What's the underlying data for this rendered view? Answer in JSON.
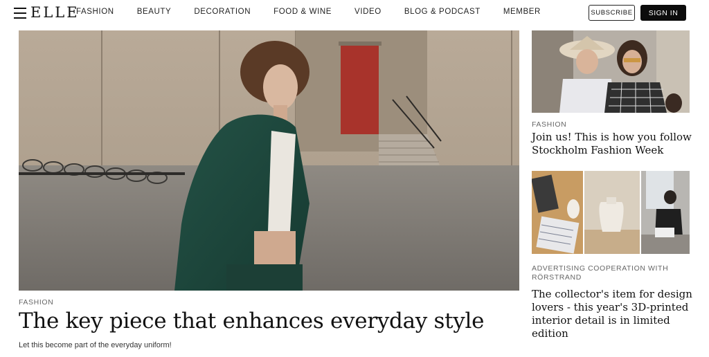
{
  "header": {
    "logo": "ELLE",
    "nav": [
      "FASHION",
      "BEAUTY",
      "DECORATION",
      "FOOD & WINE",
      "VIDEO",
      "BLOG & PODCAST",
      "MEMBER"
    ],
    "subscribe_label": "SUBSCRIBE",
    "signin_label": "SIGN IN"
  },
  "hero": {
    "category": "FASHION",
    "title": "The key piece that enhances everyday style",
    "subtitle": "Let this become part of the everyday uniform!"
  },
  "sidebar": {
    "cards": [
      {
        "category": "FASHION",
        "title": "Join us! This is how you follow Stockholm Fashion Week"
      },
      {
        "category": "ADVERTISING COOPERATION WITH RÖRSTRAND",
        "title": "The collector's item for design lovers - this year's 3D-printed interior detail is in limited edition"
      }
    ]
  },
  "colors": {
    "accent_button": "#0c0c0c",
    "blazer_green": "#1f4a3f",
    "door_red": "#a8332b"
  }
}
